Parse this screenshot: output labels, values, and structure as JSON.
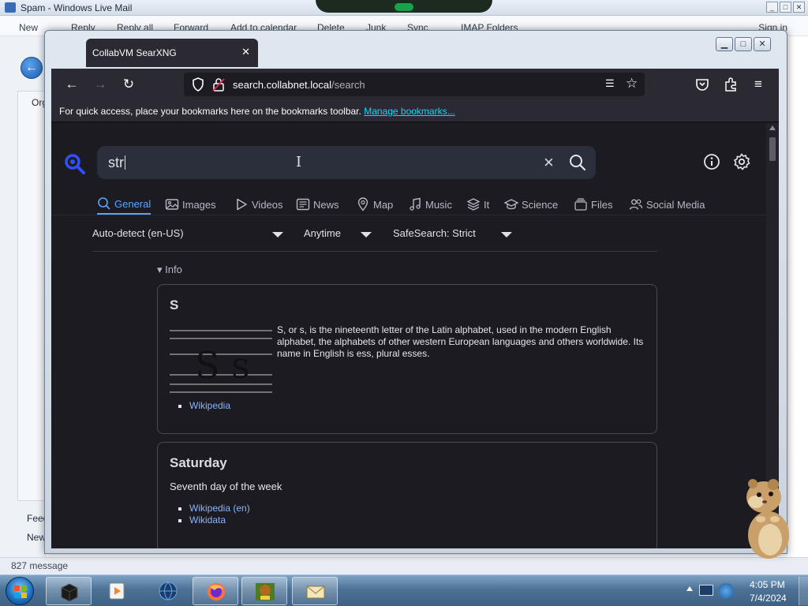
{
  "background_app": {
    "title": "Spam - Windows Live Mail",
    "toolbar": [
      "New",
      "Reply",
      "Reply all",
      "Forward",
      "Add to calendar",
      "Delete",
      "Junk",
      "Sync",
      "IMAP Folders"
    ],
    "sign_in": "Sign in",
    "sidebar_label": "Org",
    "feeds_label": "Feed",
    "news_label": "New",
    "status_text": "827 message"
  },
  "browser": {
    "tab_title": "CollabVM SearXNG",
    "url_host": "search.collabnet.local",
    "url_path": "/search",
    "bookmarks_prompt": "For quick access, place your bookmarks here on the bookmarks toolbar.",
    "bookmarks_link": "Manage bookmarks..."
  },
  "search": {
    "query": "str",
    "categories": [
      "General",
      "Images",
      "Videos",
      "News",
      "Map",
      "Music",
      "It",
      "Science",
      "Files",
      "Social Media"
    ],
    "active_category": "General",
    "language": "Auto-detect (en-US)",
    "time_range": "Anytime",
    "safesearch": "SafeSearch: Strict",
    "info_heading": "Info",
    "results": [
      {
        "title": "S",
        "image_text": "S s",
        "description": "S, or s, is the nineteenth letter of the Latin alphabet, used in the modern English alphabet, the alphabets of other western European languages and others worldwide. Its name in English is ess, plural esses.",
        "links": [
          "Wikipedia"
        ]
      },
      {
        "title": "Saturday",
        "description": "Seventh day of the week",
        "links": [
          "Wikipedia (en)",
          "Wikidata"
        ]
      }
    ]
  },
  "taskbar": {
    "time": "4:05 PM",
    "date": "7/4/2024"
  },
  "colors": {
    "accent": "#58a6ff",
    "link": "#8ab4f8",
    "page_bg": "#1c1b22",
    "toolbar_bg": "#2b2a33"
  }
}
